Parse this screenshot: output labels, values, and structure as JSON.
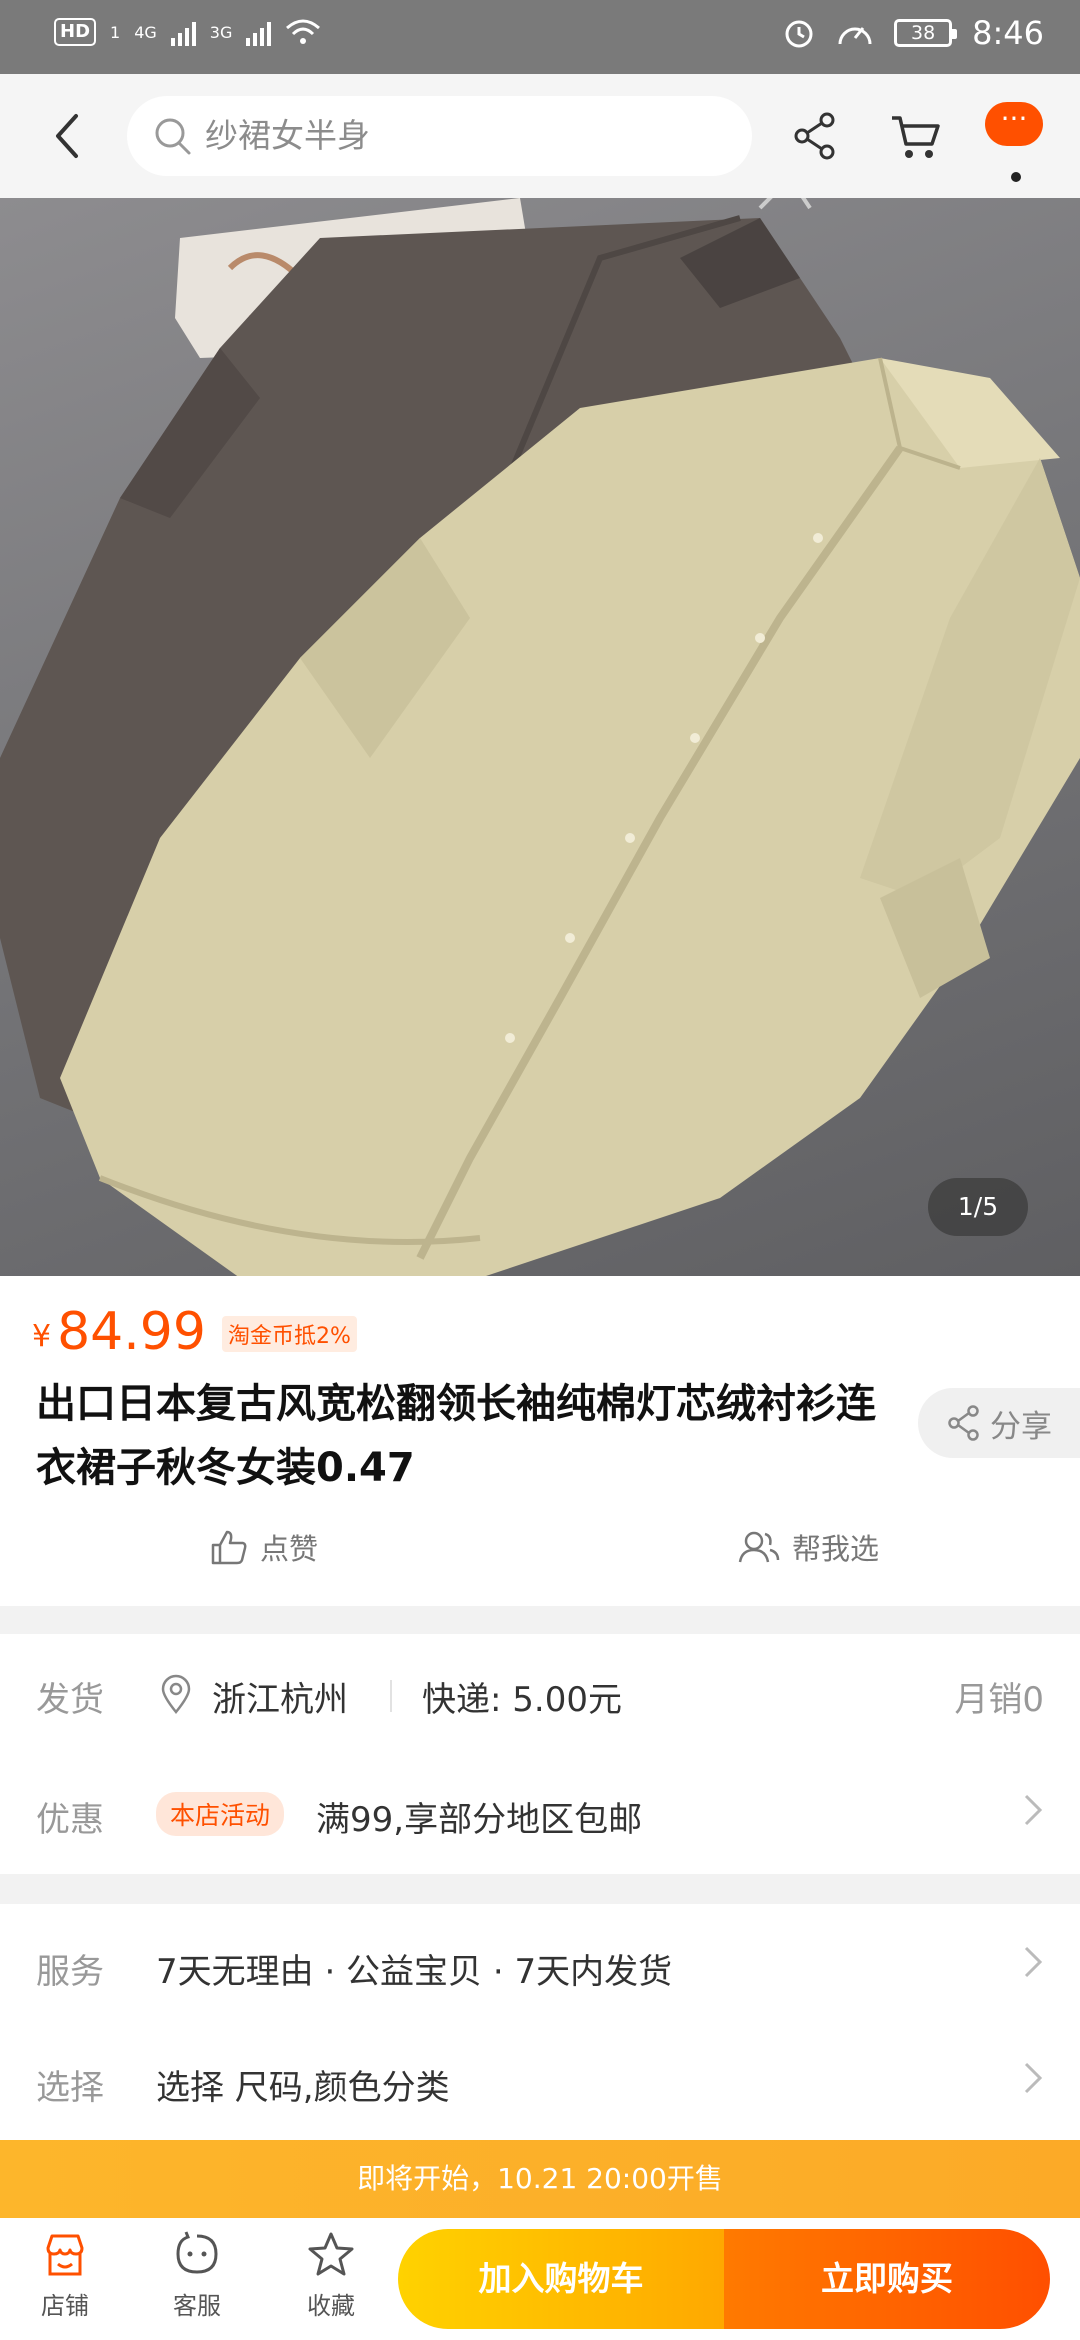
{
  "status_bar": {
    "hd": "HD",
    "sim": "1",
    "net1": "4G",
    "net2": "3G",
    "battery": "38",
    "time": "8:46"
  },
  "header": {
    "search_placeholder": "纱裙女半身",
    "more_label": "···",
    "icons": [
      "back-icon",
      "search-icon",
      "share-icon",
      "cart-icon",
      "more-icon"
    ]
  },
  "gallery": {
    "counter": "1/5"
  },
  "product": {
    "currency": "¥",
    "price": "84.99",
    "coin_tag": "淘金币抵2%",
    "title": "出口日本复古风宽松翻领长袖纯棉灯芯绒衬衫连衣裙子秋冬女装0.47",
    "share_label": "分享",
    "like_label": "点赞",
    "help_label": "帮我选"
  },
  "shipping": {
    "label": "发货",
    "location": "浙江杭州",
    "express": "快递: 5.00元",
    "monthly_sales": "月销0"
  },
  "promo": {
    "label": "优惠",
    "tag": "本店活动",
    "text": "满99,享部分地区包邮"
  },
  "service": {
    "label": "服务",
    "text": "7天无理由 · 公益宝贝 · 7天内发货"
  },
  "select": {
    "label": "选择",
    "text": "选择 尺码,颜色分类"
  },
  "banner": {
    "text": "即将开始，10.21 20:00开售"
  },
  "bottom_bar": {
    "store": "店铺",
    "service": "客服",
    "favorite": "收藏",
    "add_to_cart": "加入购物车",
    "buy_now": "立即购买"
  },
  "colors": {
    "accent": "#ff5000",
    "banner": "#fdb62b",
    "cart_button": "#ffc000",
    "buy_button": "#ff6000"
  }
}
